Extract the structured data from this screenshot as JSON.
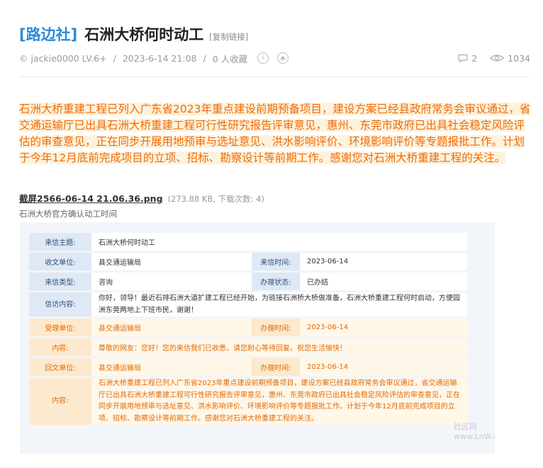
{
  "header": {
    "tag": "[路边社]",
    "title": "石洲大桥何时动工",
    "copy_link": "[复制链接]"
  },
  "meta": {
    "author": "© jackie0000 LV.6+",
    "sep1": "/",
    "date": "2023-6-14 21:08",
    "sep2": "/",
    "favorites": "0 人收藏",
    "comments": "2",
    "views": "1034"
  },
  "notice": "石洲大桥重建工程已列入广东省2023年重点建设前期预备项目，建设方案已经县政府常务会审议通过，省交通运输厅已出具石洲大桥重建工程可行性研究报告评审意见，惠州、东莞市政府已出具社会稳定风险评估的审查意见，正在同步开展用地预审与选址意见、洪水影响评价、环境影响评价等专题报批工作。计划于今年12月底前完成项目的立项、招标、勘察设计等前期工作。感谢您对石洲大桥重建工程的关注。",
  "attachment": {
    "name": "截屏2566-06-14 21.06.36.png",
    "info": "(273.88 KB, 下载次数: 4)",
    "caption": "石洲大桥官方确认动工时间"
  },
  "letter": {
    "subject_label": "来信主题:",
    "subject": "石洲大桥何时动工",
    "recv_unit_label": "收文单位:",
    "recv_unit": "县交通运输局",
    "recv_time_label": "来信时间:",
    "recv_time": "2023-06-14",
    "type_label": "来信类型:",
    "type": "咨询",
    "status_label": "办理状态:",
    "status": "已办结",
    "content_label": "信访内容:",
    "content": "你好，领导！最近石排石洲大道扩建工程已经开始，为链接石洲桥大桥做准备，石洲大桥重建工程何时启动，方便园洲东莞两地上下班市民，谢谢！",
    "handle_unit_label": "受理单位:",
    "handle_unit": "县交通运输局",
    "handle_time_label": "办理时间:",
    "handle_time": "2023-06-14",
    "ack_label": "内容:",
    "ack": "尊敬的网友：您好！您的来信我们已收悉，请您耐心等待回复。祝您生活愉快！",
    "reply_unit_label": "回文单位:",
    "reply_unit": "县交通运输局",
    "reply_time_label": "办理时间:",
    "reply_time": "2023-06-14",
    "reply_label": "内容:",
    "reply": "石洲大桥重建工程已列入广东省2023年重点建设前期预备项目，建设方案已经县政府常务会审议通过，省交通运输厅已出具石洲大桥重建工程可行性研究报告评审意见，惠州、东莞市政府已出具社会稳定风险评估的审查意见，正在同步开展用地预审与选址意见、洪水影响评价、环境影响评价等专题报批工作。计划于今年12月底前完成项目的立项、招标、勘察设计等前期工作。感谢您对石洲大桥重建工程的关注。"
  },
  "watermark": {
    "line1": "社区网",
    "line2": "www.LnW.com"
  },
  "colors": {
    "tag": "#2b8ad8",
    "notice_text": "#f06a05",
    "notice_bg": "#fdf3dd"
  },
  "icons": [
    "info-icon",
    "share-icon",
    "comment-icon",
    "eye-icon"
  ]
}
